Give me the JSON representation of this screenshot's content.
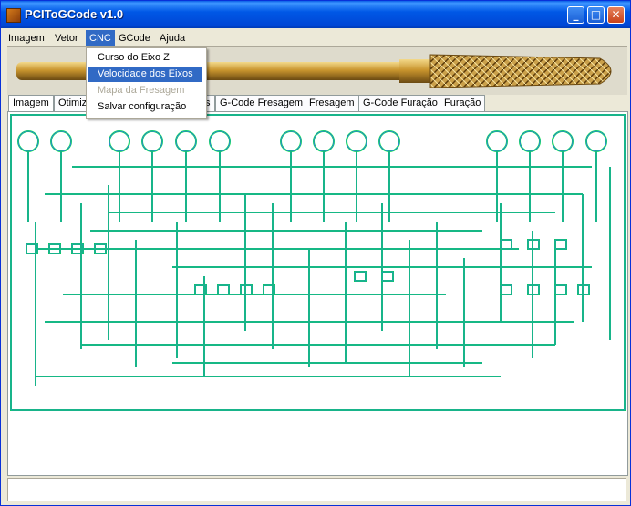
{
  "window": {
    "title": "PCIToGCode  v1.0",
    "minimize": "_",
    "maximize": "□",
    "close": "✕"
  },
  "menu": {
    "imagem": "Imagem",
    "vetor": "Vetor",
    "cnc": "CNC",
    "gcode": "GCode",
    "ajuda": "Ajuda"
  },
  "cnc_menu": {
    "curso": "Curso do Eixo Z",
    "velocidade": "Velocidade dos Eixos",
    "mapa": "Mapa da Fresagem",
    "salvar": "Salvar configuração"
  },
  "tabs": {
    "imagem": "Imagem",
    "otimiz": "Otimiz",
    "hidden_end": "s",
    "gcode_fresagem": "G-Code Fresagem",
    "fresagem": "Fresagem",
    "gcode_furacao": "G-Code Furação",
    "furacao": "Furação"
  },
  "colors": {
    "trace_outer": "#00e63c",
    "trace_inner": "#3d6bff",
    "selection": "#316ac5",
    "titlebar": "#0054e3"
  }
}
